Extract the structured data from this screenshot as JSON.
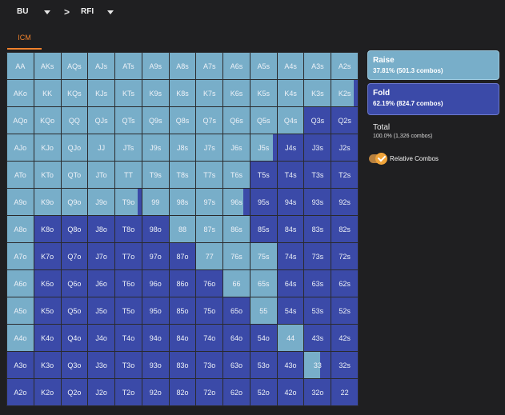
{
  "nav": {
    "position": "BU",
    "separator": ">",
    "action": "RFI",
    "position_caret_icon": "chevron-down-icon",
    "action_caret_icon": "chevron-down-icon"
  },
  "tabs": [
    {
      "label": "ICM",
      "active": true
    }
  ],
  "colors": {
    "raise": "#78aec9",
    "fold": "#3b4aa8",
    "accent": "#f0822c"
  },
  "grid": {
    "rows": [
      [
        {
          "label": "AA",
          "raise": 1
        },
        {
          "label": "AKs",
          "raise": 1
        },
        {
          "label": "AQs",
          "raise": 1
        },
        {
          "label": "AJs",
          "raise": 1
        },
        {
          "label": "ATs",
          "raise": 1
        },
        {
          "label": "A9s",
          "raise": 1
        },
        {
          "label": "A8s",
          "raise": 1
        },
        {
          "label": "A7s",
          "raise": 1
        },
        {
          "label": "A6s",
          "raise": 1
        },
        {
          "label": "A5s",
          "raise": 1
        },
        {
          "label": "A4s",
          "raise": 1
        },
        {
          "label": "A3s",
          "raise": 1
        },
        {
          "label": "A2s",
          "raise": 1
        }
      ],
      [
        {
          "label": "AKo",
          "raise": 1
        },
        {
          "label": "KK",
          "raise": 1
        },
        {
          "label": "KQs",
          "raise": 1
        },
        {
          "label": "KJs",
          "raise": 1
        },
        {
          "label": "KTs",
          "raise": 1
        },
        {
          "label": "K9s",
          "raise": 1
        },
        {
          "label": "K8s",
          "raise": 1
        },
        {
          "label": "K7s",
          "raise": 1
        },
        {
          "label": "K6s",
          "raise": 1
        },
        {
          "label": "K5s",
          "raise": 1
        },
        {
          "label": "K4s",
          "raise": 1
        },
        {
          "label": "K3s",
          "raise": 1
        },
        {
          "label": "K2s",
          "raise": 0.85
        }
      ],
      [
        {
          "label": "AQo",
          "raise": 1
        },
        {
          "label": "KQo",
          "raise": 1
        },
        {
          "label": "QQ",
          "raise": 1
        },
        {
          "label": "QJs",
          "raise": 1
        },
        {
          "label": "QTs",
          "raise": 1
        },
        {
          "label": "Q9s",
          "raise": 1
        },
        {
          "label": "Q8s",
          "raise": 1
        },
        {
          "label": "Q7s",
          "raise": 1
        },
        {
          "label": "Q6s",
          "raise": 1
        },
        {
          "label": "Q5s",
          "raise": 1
        },
        {
          "label": "Q4s",
          "raise": 1
        },
        {
          "label": "Q3s",
          "raise": 0
        },
        {
          "label": "Q2s",
          "raise": 0
        }
      ],
      [
        {
          "label": "AJo",
          "raise": 1
        },
        {
          "label": "KJo",
          "raise": 1
        },
        {
          "label": "QJo",
          "raise": 1
        },
        {
          "label": "JJ",
          "raise": 1
        },
        {
          "label": "JTs",
          "raise": 1
        },
        {
          "label": "J9s",
          "raise": 1
        },
        {
          "label": "J8s",
          "raise": 1
        },
        {
          "label": "J7s",
          "raise": 1
        },
        {
          "label": "J6s",
          "raise": 1
        },
        {
          "label": "J5s",
          "raise": 0.85
        },
        {
          "label": "J4s",
          "raise": 0
        },
        {
          "label": "J3s",
          "raise": 0
        },
        {
          "label": "J2s",
          "raise": 0
        }
      ],
      [
        {
          "label": "ATo",
          "raise": 1
        },
        {
          "label": "KTo",
          "raise": 1
        },
        {
          "label": "QTo",
          "raise": 1
        },
        {
          "label": "JTo",
          "raise": 1
        },
        {
          "label": "TT",
          "raise": 1
        },
        {
          "label": "T9s",
          "raise": 1
        },
        {
          "label": "T8s",
          "raise": 1
        },
        {
          "label": "T7s",
          "raise": 1
        },
        {
          "label": "T6s",
          "raise": 1
        },
        {
          "label": "T5s",
          "raise": 0
        },
        {
          "label": "T4s",
          "raise": 0
        },
        {
          "label": "T3s",
          "raise": 0
        },
        {
          "label": "T2s",
          "raise": 0
        }
      ],
      [
        {
          "label": "A9o",
          "raise": 1
        },
        {
          "label": "K9o",
          "raise": 1
        },
        {
          "label": "Q9o",
          "raise": 1
        },
        {
          "label": "J9o",
          "raise": 1
        },
        {
          "label": "T9o",
          "raise": 0.85
        },
        {
          "label": "99",
          "raise": 1
        },
        {
          "label": "98s",
          "raise": 1
        },
        {
          "label": "97s",
          "raise": 1
        },
        {
          "label": "96s",
          "raise": 0.75
        },
        {
          "label": "95s",
          "raise": 0
        },
        {
          "label": "94s",
          "raise": 0
        },
        {
          "label": "93s",
          "raise": 0
        },
        {
          "label": "92s",
          "raise": 0
        }
      ],
      [
        {
          "label": "A8o",
          "raise": 1
        },
        {
          "label": "K8o",
          "raise": 0
        },
        {
          "label": "Q8o",
          "raise": 0
        },
        {
          "label": "J8o",
          "raise": 0
        },
        {
          "label": "T8o",
          "raise": 0
        },
        {
          "label": "98o",
          "raise": 0
        },
        {
          "label": "88",
          "raise": 1
        },
        {
          "label": "87s",
          "raise": 1
        },
        {
          "label": "86s",
          "raise": 1
        },
        {
          "label": "85s",
          "raise": 0
        },
        {
          "label": "84s",
          "raise": 0
        },
        {
          "label": "83s",
          "raise": 0
        },
        {
          "label": "82s",
          "raise": 0
        }
      ],
      [
        {
          "label": "A7o",
          "raise": 1
        },
        {
          "label": "K7o",
          "raise": 0
        },
        {
          "label": "Q7o",
          "raise": 0
        },
        {
          "label": "J7o",
          "raise": 0
        },
        {
          "label": "T7o",
          "raise": 0
        },
        {
          "label": "97o",
          "raise": 0
        },
        {
          "label": "87o",
          "raise": 0
        },
        {
          "label": "77",
          "raise": 1
        },
        {
          "label": "76s",
          "raise": 1
        },
        {
          "label": "75s",
          "raise": 1
        },
        {
          "label": "74s",
          "raise": 0
        },
        {
          "label": "73s",
          "raise": 0
        },
        {
          "label": "72s",
          "raise": 0
        }
      ],
      [
        {
          "label": "A6o",
          "raise": 1
        },
        {
          "label": "K6o",
          "raise": 0
        },
        {
          "label": "Q6o",
          "raise": 0
        },
        {
          "label": "J6o",
          "raise": 0
        },
        {
          "label": "T6o",
          "raise": 0
        },
        {
          "label": "96o",
          "raise": 0
        },
        {
          "label": "86o",
          "raise": 0
        },
        {
          "label": "76o",
          "raise": 0
        },
        {
          "label": "66",
          "raise": 1
        },
        {
          "label": "65s",
          "raise": 1
        },
        {
          "label": "64s",
          "raise": 0
        },
        {
          "label": "63s",
          "raise": 0
        },
        {
          "label": "62s",
          "raise": 0
        }
      ],
      [
        {
          "label": "A5o",
          "raise": 1
        },
        {
          "label": "K5o",
          "raise": 0
        },
        {
          "label": "Q5o",
          "raise": 0
        },
        {
          "label": "J5o",
          "raise": 0
        },
        {
          "label": "T5o",
          "raise": 0
        },
        {
          "label": "95o",
          "raise": 0
        },
        {
          "label": "85o",
          "raise": 0
        },
        {
          "label": "75o",
          "raise": 0
        },
        {
          "label": "65o",
          "raise": 0
        },
        {
          "label": "55",
          "raise": 1
        },
        {
          "label": "54s",
          "raise": 0
        },
        {
          "label": "53s",
          "raise": 0
        },
        {
          "label": "52s",
          "raise": 0
        }
      ],
      [
        {
          "label": "A4o",
          "raise": 1
        },
        {
          "label": "K4o",
          "raise": 0
        },
        {
          "label": "Q4o",
          "raise": 0
        },
        {
          "label": "J4o",
          "raise": 0
        },
        {
          "label": "T4o",
          "raise": 0
        },
        {
          "label": "94o",
          "raise": 0
        },
        {
          "label": "84o",
          "raise": 0
        },
        {
          "label": "74o",
          "raise": 0
        },
        {
          "label": "64o",
          "raise": 0
        },
        {
          "label": "54o",
          "raise": 0
        },
        {
          "label": "44",
          "raise": 1
        },
        {
          "label": "43s",
          "raise": 0
        },
        {
          "label": "42s",
          "raise": 0
        }
      ],
      [
        {
          "label": "A3o",
          "raise": 0
        },
        {
          "label": "K3o",
          "raise": 0
        },
        {
          "label": "Q3o",
          "raise": 0
        },
        {
          "label": "J3o",
          "raise": 0
        },
        {
          "label": "T3o",
          "raise": 0
        },
        {
          "label": "93o",
          "raise": 0
        },
        {
          "label": "83o",
          "raise": 0
        },
        {
          "label": "73o",
          "raise": 0
        },
        {
          "label": "63o",
          "raise": 0
        },
        {
          "label": "53o",
          "raise": 0
        },
        {
          "label": "43o",
          "raise": 0
        },
        {
          "label": "33",
          "raise": 0.6
        },
        {
          "label": "32s",
          "raise": 0
        }
      ],
      [
        {
          "label": "A2o",
          "raise": 0
        },
        {
          "label": "K2o",
          "raise": 0
        },
        {
          "label": "Q2o",
          "raise": 0
        },
        {
          "label": "J2o",
          "raise": 0
        },
        {
          "label": "T2o",
          "raise": 0
        },
        {
          "label": "92o",
          "raise": 0
        },
        {
          "label": "82o",
          "raise": 0
        },
        {
          "label": "72o",
          "raise": 0
        },
        {
          "label": "62o",
          "raise": 0
        },
        {
          "label": "52o",
          "raise": 0
        },
        {
          "label": "42o",
          "raise": 0
        },
        {
          "label": "32o",
          "raise": 0
        },
        {
          "label": "22",
          "raise": 0
        }
      ]
    ]
  },
  "summary": {
    "raise": {
      "title": "Raise",
      "detail": "37.81% (501.3 combos)"
    },
    "fold": {
      "title": "Fold",
      "detail": "62.19% (824.7 combos)"
    },
    "total": {
      "title": "Total",
      "detail": "100.0% (1,326 combos)"
    }
  },
  "toggle": {
    "label": "Relative Combos",
    "on": true,
    "icon": "check-icon"
  }
}
